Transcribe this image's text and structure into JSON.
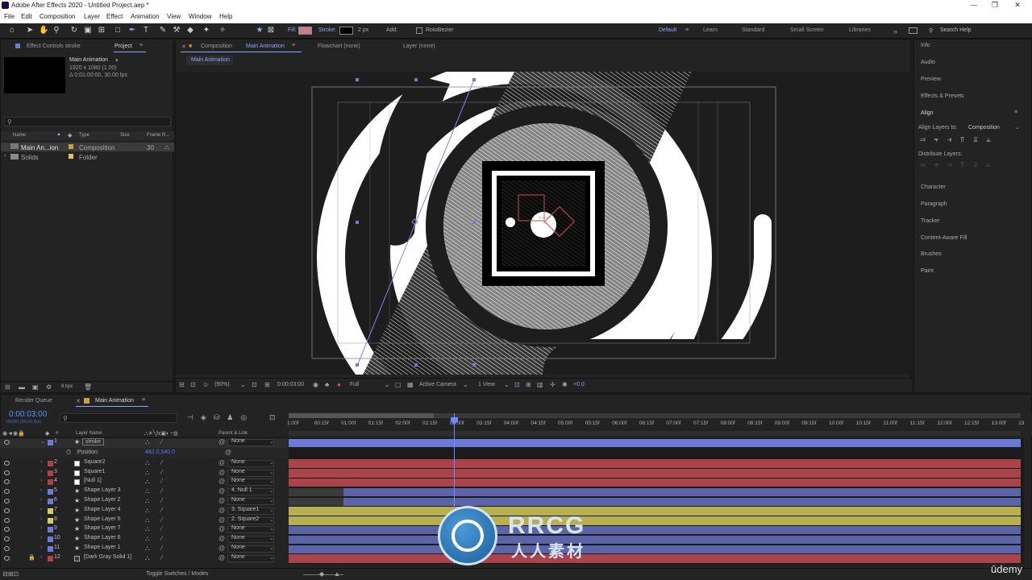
{
  "app": {
    "title": "Adobe After Effects 2020 - Untitled Project.aep *",
    "win_minimize": "—",
    "win_restore": "❐",
    "win_close": "✕"
  },
  "menu": [
    "File",
    "Edit",
    "Composition",
    "Layer",
    "Effect",
    "Animation",
    "View",
    "Window",
    "Help"
  ],
  "toolbar": {
    "fill_label": "Fill:",
    "stroke_label": "Stroke:",
    "stroke_px": "2 px",
    "add_label": "Add:",
    "rotobezier_label": "RotoBezier",
    "workspaces": [
      "Default",
      "Learn",
      "Standard",
      "Small Screen",
      "Libraries"
    ],
    "search_placeholder": "Search Help"
  },
  "left_panel": {
    "tab_effect": "Effect Controls stroke",
    "tab_project": "Project",
    "comp_name": "Main Animation",
    "comp_info1": "1920 x 1080 (1.00)",
    "comp_info2": "Δ 0:01:00:00, 30.00 fps",
    "search_placeholder": "",
    "columns": [
      "Name",
      "Type",
      "Size",
      "Frame R..."
    ],
    "items": [
      {
        "name": "Main An...ion",
        "type": "Composition",
        "rate": "30",
        "color": "#c9a13a"
      },
      {
        "name": "Solids",
        "type": "Folder",
        "rate": "",
        "color": "#e0c25a"
      }
    ],
    "bpc": "8 bpc"
  },
  "comp_panel": {
    "tab_lock": "Composition",
    "tab_name": "Main Animation",
    "flowchart": "Flowchart (none)",
    "layer": "Layer (none)",
    "comp_tab": "Main Animation",
    "zoom": "(50%)",
    "timecode": "0:00:03:00",
    "quality": "Full",
    "camera": "Active Camera",
    "views": "1 View",
    "exposure": "+0.0"
  },
  "right_panel": {
    "items": [
      "Info",
      "Audio",
      "Preview",
      "Effects & Presets"
    ],
    "align_title": "Align",
    "align_layers_to": "Align Layers to:",
    "align_target": "Composition",
    "distribute_layers": "Distribute Layers:",
    "items2": [
      "Character",
      "Paragraph",
      "Tracker",
      "Content-Aware Fill",
      "Brushes",
      "Paint"
    ]
  },
  "timeline": {
    "tab_render": "Render Queue",
    "tab_comp": "Main Animation",
    "timecode": "0:00:03:00",
    "frames": "00090 (30.00 fps)",
    "search_placeholder": "",
    "col_layer_name": "Layer Name",
    "col_parent": "Parent & Link",
    "position_label": "Position",
    "position_value": "482.0,540.0",
    "toggle_label": "Toggle Switches / Modes",
    "ruler": [
      "1:00f",
      "00:15f",
      "01:00f",
      "01:15f",
      "02:00f",
      "02:15f",
      "03:00f",
      "03:15f",
      "04:00f",
      "04:15f",
      "05:00f",
      "05:15f",
      "06:00f",
      "06:15f",
      "07:00f",
      "07:15f",
      "08:00f",
      "08:15f",
      "09:00f",
      "09:15f",
      "10:00f",
      "10:15f",
      "11:00f",
      "11:15f",
      "12:00f",
      "12:15f",
      "13:00f",
      "13"
    ],
    "layers": [
      {
        "num": "1",
        "name": "stroke",
        "parent": "None",
        "label": "#6c7bd8",
        "icon": "star",
        "bar": "#6c7bd8",
        "start": 0
      },
      {
        "num": "2",
        "name": "Square2",
        "parent": "None",
        "label": "#b04246",
        "icon": "box",
        "bar": "#a8444a",
        "start": 0
      },
      {
        "num": "3",
        "name": "Square1",
        "parent": "None",
        "label": "#b04246",
        "icon": "box",
        "bar": "#a8444a",
        "start": 0
      },
      {
        "num": "4",
        "name": "[Null 1]",
        "parent": "None",
        "label": "#b04246",
        "icon": "box",
        "bar": "#a8444a",
        "start": 0
      },
      {
        "num": "5",
        "name": "Shape Layer 3",
        "parent": "4. Null 1",
        "label": "#6c7bd8",
        "icon": "star",
        "bar": "#5b64a8",
        "start": 0.075
      },
      {
        "num": "6",
        "name": "Shape Layer 2",
        "parent": "None",
        "label": "#6c7bd8",
        "icon": "star",
        "bar": "#5b64a8",
        "start": 0.075
      },
      {
        "num": "7",
        "name": "Shape Layer 4",
        "parent": "3. Square1",
        "label": "#d4cf5a",
        "icon": "star",
        "bar": "#b8b050",
        "start": 0
      },
      {
        "num": "8",
        "name": "Shape Layer 5",
        "parent": "2. Square2",
        "label": "#d4cf5a",
        "icon": "star",
        "bar": "#b8b050",
        "start": 0
      },
      {
        "num": "9",
        "name": "Shape Layer 7",
        "parent": "None",
        "label": "#6c7bd8",
        "icon": "star",
        "bar": "#5b64a8",
        "start": 0
      },
      {
        "num": "10",
        "name": "Shape Layer 6",
        "parent": "None",
        "label": "#6c7bd8",
        "icon": "star",
        "bar": "#5b64a8",
        "start": 0
      },
      {
        "num": "11",
        "name": "Shape Layer 1",
        "parent": "None",
        "label": "#6c7bd8",
        "icon": "star",
        "bar": "#5b64a8",
        "start": 0
      },
      {
        "num": "12",
        "name": "[Dark Gray Solid 1]",
        "parent": "None",
        "label": "#b04246",
        "icon": "solid",
        "bar": "#a8444a",
        "start": 0
      }
    ]
  },
  "watermark": {
    "brand": "RRCG",
    "sub": "人人素材",
    "udemy": "ūdemy"
  }
}
